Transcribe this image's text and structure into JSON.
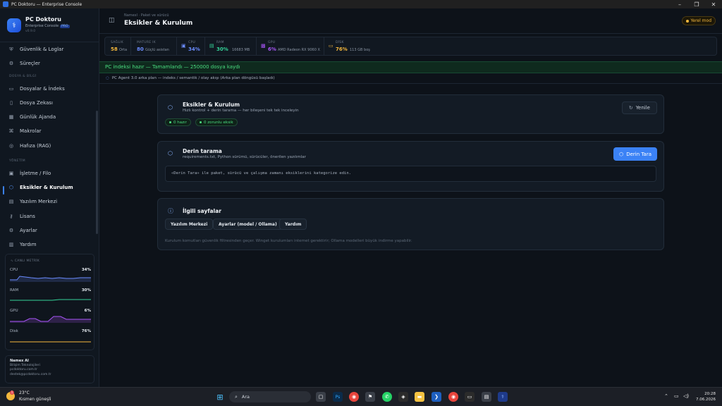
{
  "window": {
    "title": "PC Doktoru — Enterprise Console"
  },
  "sidebar": {
    "brand_name": "PC Doktoru",
    "brand_sub": "Enterprise Console",
    "brand_badge": "PRO",
    "brand_ver": "v0.9.0",
    "items_top": [
      {
        "label": "Güvenlik & Loglar",
        "icon": "shield-icon"
      },
      {
        "label": "Süreçler",
        "icon": "process-icon"
      }
    ],
    "section_files": "DOSYA & BİLGİ",
    "items_files": [
      {
        "label": "Dosyalar & İndeks",
        "icon": "folder-icon"
      },
      {
        "label": "Dosya Zekası",
        "icon": "file-icon"
      },
      {
        "label": "Günlük Ajanda",
        "icon": "calendar-icon"
      },
      {
        "label": "Makrolar",
        "icon": "macro-icon"
      },
      {
        "label": "Hafıza (RAG)",
        "icon": "memory-icon"
      }
    ],
    "section_manage": "YÖNETİM",
    "items_manage": [
      {
        "label": "İşletme / Filo",
        "icon": "fleet-icon"
      },
      {
        "label": "Eksikler & Kurulum",
        "icon": "package-icon",
        "active": true
      },
      {
        "label": "Yazılım Merkezi",
        "icon": "software-icon"
      },
      {
        "label": "Lisans",
        "icon": "key-icon"
      },
      {
        "label": "Ayarlar",
        "icon": "gear-icon"
      },
      {
        "label": "Yardım",
        "icon": "book-icon"
      }
    ],
    "metrics": {
      "title": "CANLI METRİK",
      "rows": [
        {
          "label": "CPU",
          "value": "34%",
          "color": "#6b8cff"
        },
        {
          "label": "RAM",
          "value": "30%",
          "color": "#34d399"
        },
        {
          "label": "GPU",
          "value": "6%",
          "color": "#a855f7"
        },
        {
          "label": "Disk",
          "value": "76%",
          "color": "#f5b83d"
        }
      ]
    },
    "company": {
      "name": "Namex AI",
      "line1": "Bilişim Teknolojileri",
      "line2": "pcdoktoru.com.tr",
      "line3": "destek@pcdoktoru.com.tr"
    }
  },
  "header": {
    "breadcrumb": "Namexl · Paket ve sürücü",
    "title": "Eksikler & Kurulum",
    "mode_badge": "Yerel mod"
  },
  "stats": [
    {
      "label": "SAĞLIK",
      "value": "58",
      "detail": "Orta",
      "color": "#f5b83d"
    },
    {
      "label": "MATURE IK",
      "value": "80",
      "detail": "Güçlü asistan",
      "color": "#6b8cff"
    },
    {
      "label": "CPU",
      "value": "34%",
      "detail": "",
      "color": "#6b8cff",
      "icon": "cpu-icon"
    },
    {
      "label": "RAM",
      "value": "30%",
      "detail": "16683 MB",
      "color": "#34d399",
      "icon": "ram-icon"
    },
    {
      "label": "GPU",
      "value": "6%",
      "detail": "AMD Radeon RX 9060 X",
      "color": "#a855f7",
      "icon": "gpu-icon"
    },
    {
      "label": "DİSK",
      "value": "76%",
      "detail": "113 GB boş",
      "color": "#f5b83d",
      "icon": "disk-icon"
    }
  ],
  "banner": {
    "index_text": "PC indeksi hazır — Tamamlandı — 250000 dosya kaydı",
    "agent_text": "PC Agent 3.0 arka plan — indeks / semantik / olay akışı (Arka plan döngüsü başladı)"
  },
  "card_missing": {
    "title": "Eksikler & Kurulum",
    "subtitle": "Hızlı kontrol + derin tarama — her bileşeni tek tek inceleyin",
    "pill_ready": "0 hazır",
    "pill_required": "0 zorunlu eksik",
    "refresh_label": "Yenile"
  },
  "card_deep": {
    "title": "Derin tarama",
    "subtitle": "requirements.txt, Python sürümü, sürücüler, önerilen yazılımlar",
    "scan_label": "Derin Tara",
    "output": "«Derin Tara» ile paket, sürücü ve çalışma zamanı eksiklerini kategorize edin."
  },
  "card_related": {
    "title": "İlgili sayfalar",
    "buttons": [
      "Yazılım Merkezi",
      "Ayarlar (model / Ollama)",
      "Yardım"
    ],
    "note": "Kurulum komutları güvenlik filtresinden geçer. Winget kurulumları internet gerektirir; Ollama modelleri büyük indirme yapabilir."
  },
  "taskbar": {
    "temp": "23°C",
    "weather": "Kısmen güneşli",
    "weather_badge": "1",
    "search": "Ara",
    "time": "20:28",
    "date": "7.06.2026"
  }
}
